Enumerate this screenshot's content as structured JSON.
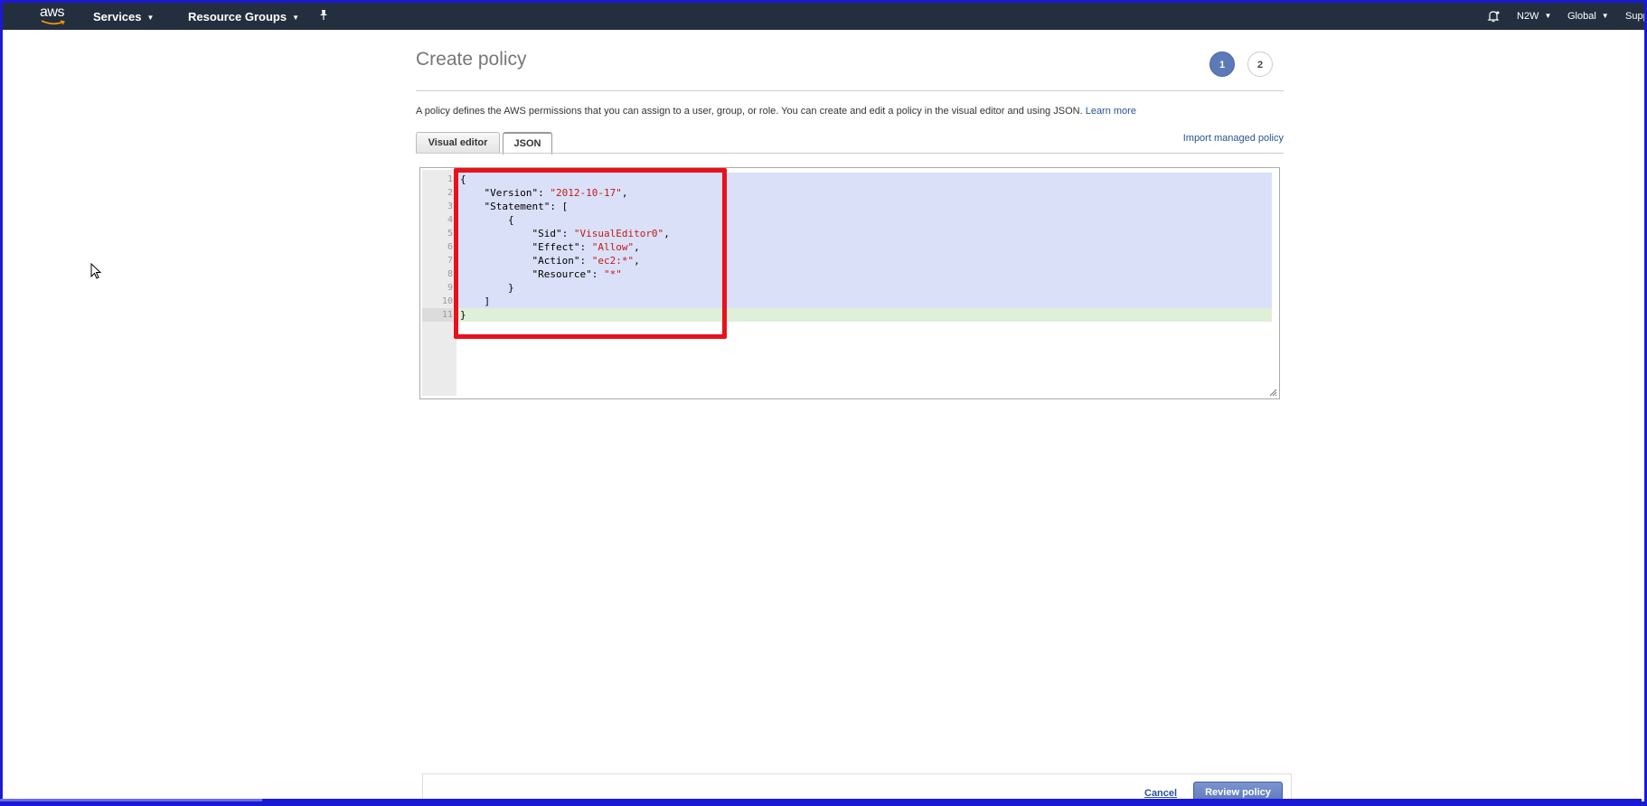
{
  "nav": {
    "logo": "aws",
    "services": "Services",
    "resource_groups": "Resource Groups",
    "account": "N2W",
    "region": "Global",
    "support": "Supp"
  },
  "page": {
    "title": "Create policy",
    "step1": "1",
    "step2": "2",
    "description": "A policy defines the AWS permissions that you can assign to a user, group, or role. You can create and edit a policy in the visual editor and using JSON.",
    "learn_more": "Learn more"
  },
  "tabs": {
    "visual": "Visual editor",
    "json": "JSON",
    "import": "Import managed policy"
  },
  "editor": {
    "line_numbers": [
      "1",
      "2",
      "3",
      "4",
      "5",
      "6",
      "7",
      "8",
      "9",
      "10",
      "11"
    ],
    "lines": [
      {
        "indent": "",
        "key": "{",
        "value": "",
        "tail": ""
      },
      {
        "indent": "    ",
        "key": "\"Version\": ",
        "value": "\"2012-10-17\"",
        "tail": ","
      },
      {
        "indent": "    ",
        "key": "\"Statement\": [",
        "value": "",
        "tail": ""
      },
      {
        "indent": "        ",
        "key": "{",
        "value": "",
        "tail": ""
      },
      {
        "indent": "            ",
        "key": "\"Sid\": ",
        "value": "\"VisualEditor0\"",
        "tail": ","
      },
      {
        "indent": "            ",
        "key": "\"Effect\": ",
        "value": "\"Allow\"",
        "tail": ","
      },
      {
        "indent": "            ",
        "key": "\"Action\": ",
        "value": "\"ec2:*\"",
        "tail": ","
      },
      {
        "indent": "            ",
        "key": "\"Resource\": ",
        "value": "\"*\"",
        "tail": ""
      },
      {
        "indent": "        ",
        "key": "}",
        "value": "",
        "tail": ""
      },
      {
        "indent": "    ",
        "key": "]",
        "value": "",
        "tail": ""
      },
      {
        "indent": "",
        "key": "}",
        "value": "",
        "tail": ""
      }
    ]
  },
  "footer": {
    "cancel": "Cancel",
    "review": "Review policy"
  },
  "colors": {
    "nav_bg": "#232f3e",
    "accent": "#5d7ab8",
    "highlight": "#e8111c",
    "string": "#c41a16"
  }
}
